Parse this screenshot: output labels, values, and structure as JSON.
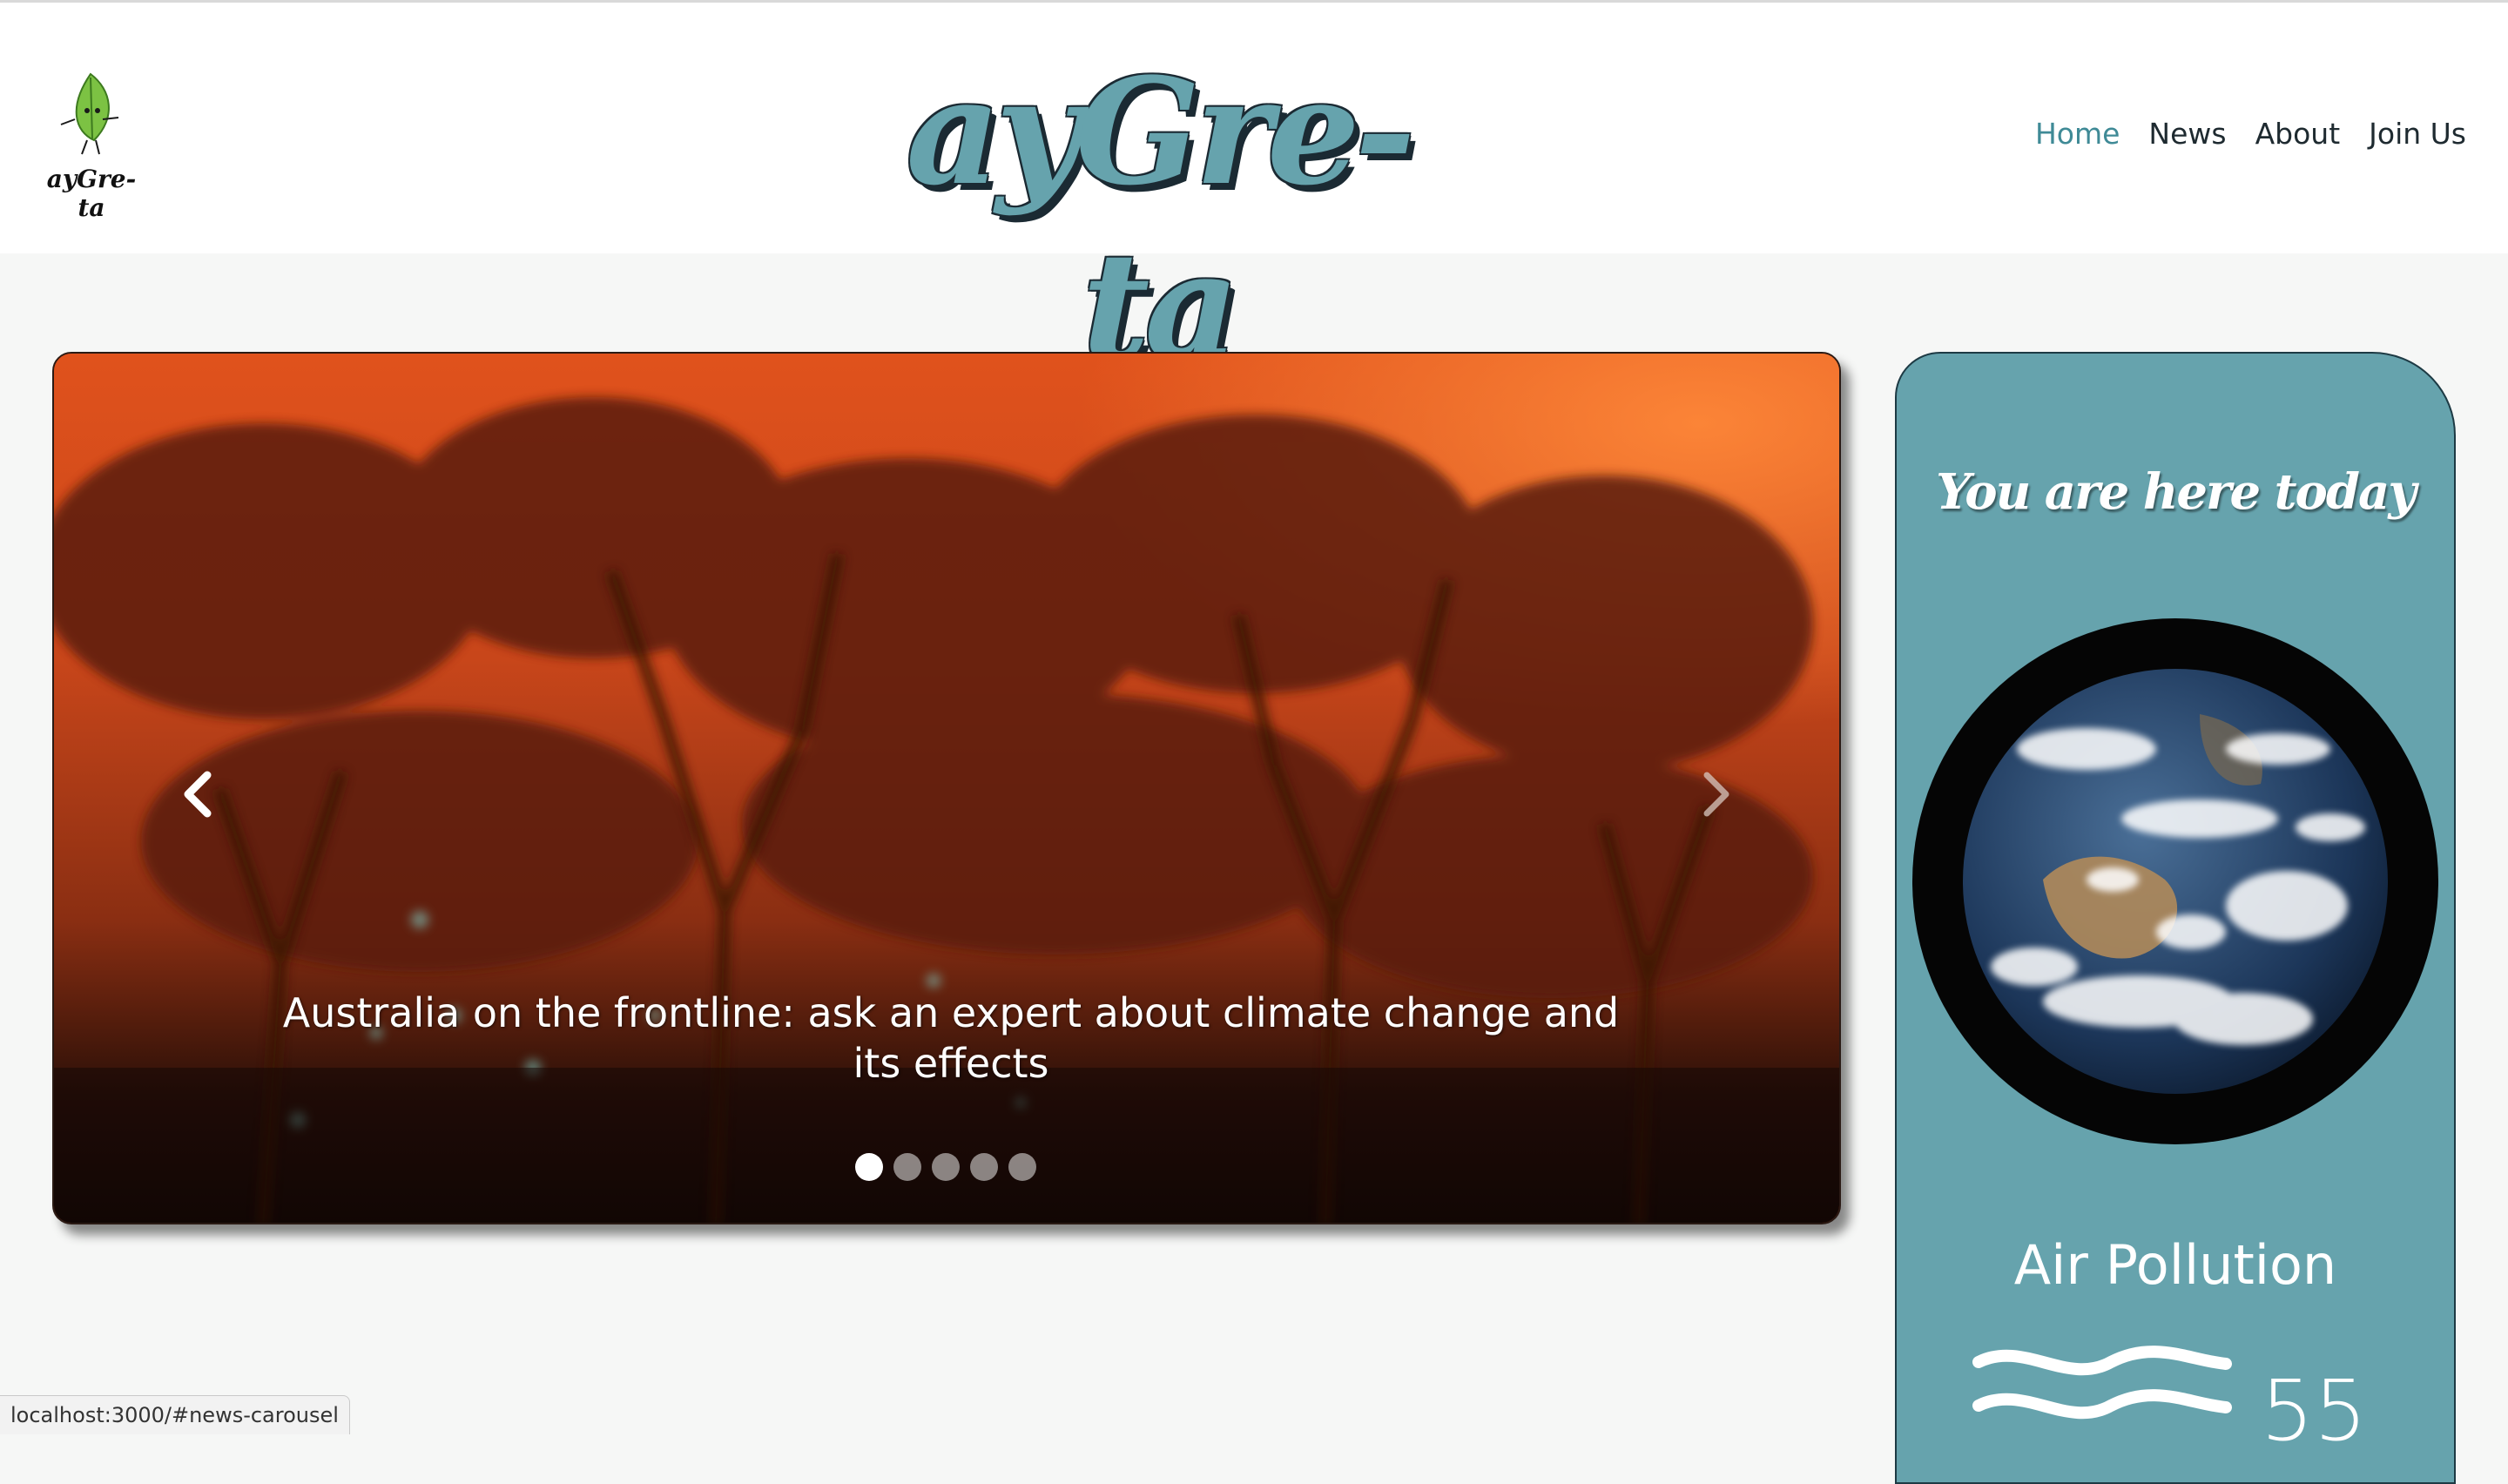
{
  "header": {
    "logo_text": "ayGre-ta",
    "brand_title": "ayGre-ta",
    "nav": [
      {
        "label": "Home",
        "active": true
      },
      {
        "label": "News",
        "active": false
      },
      {
        "label": "About",
        "active": false
      },
      {
        "label": "Join Us",
        "active": false
      }
    ]
  },
  "carousel": {
    "caption": "Australia on the frontline: ask an expert about climate change and its effects",
    "slide_count": 5,
    "active_slide": 1,
    "prev_icon": "chevron-left-icon",
    "next_icon": "chevron-right-icon"
  },
  "panel": {
    "title": "You are here today",
    "metric_label": "Air Pollution",
    "metric_value": "55",
    "metric_icon": "wind-waves-icon"
  },
  "status_bar": {
    "url": "localhost:3000/#news-carousel"
  },
  "colors": {
    "accent": "#66a3ad",
    "nav_active": "#3f8a96",
    "page_bg": "#f6f7f6"
  }
}
